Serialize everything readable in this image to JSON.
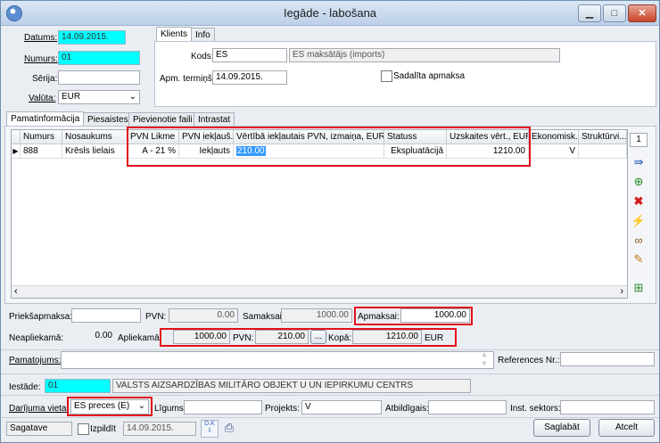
{
  "window": {
    "title": "Iegāde - labošana",
    "minimize": "▁",
    "maximize": "□",
    "close": "✕"
  },
  "header": {
    "datums_label": "Datums:",
    "datums_value": "14.09.2015.",
    "numurs_label": "Numurs:",
    "numurs_value": "01",
    "serija_label": "Sērija:",
    "serija_value": "",
    "valuta_label": "Valūta:",
    "valuta_value": "EUR"
  },
  "client": {
    "tabs": [
      "Klients",
      "Info"
    ],
    "kods_label": "Kods:",
    "kods_value": "ES",
    "kods_name": "ES maksātājs (imports)",
    "term_label": "Apm. termiņš:",
    "term_value": "14.09.2015.",
    "split_label": "Sadalīta apmaksa"
  },
  "main_tabs": [
    "Pamatinformācija",
    "Piesaistes",
    "Pievienotie faili",
    "Intrastat"
  ],
  "grid": {
    "columns": [
      "Numurs",
      "Nosaukums",
      "PVN Likme",
      "PVN iekļaušana",
      "Vērtībā iekļautais PVN, izmaiņa, EUR",
      "Statuss",
      "Uzskaites vērt., EUR",
      "Ekonomiskā",
      "Struktūrvienība"
    ],
    "columns_display": [
      "Numurs",
      "Nosaukums",
      "PVN Likme",
      "PVN iekļauš...",
      "Vērtībā iekļautais PVN, izmaiņa, EUR",
      "Statuss",
      "Uzskaites vērt., EUR",
      "Ekonomisk...",
      "Struktūrvi..."
    ],
    "row": {
      "numurs": "888",
      "nosaukums": "Krēsls lielais",
      "pvn_likme": "A - 21 %",
      "pvn_ieklausana": "Iekļauts",
      "vertiba": "210.00",
      "statuss": "Ekspluatācijā",
      "uzskaites": "1210.00",
      "ekonomiska": "V",
      "struktura": ""
    },
    "side_count": "1"
  },
  "totals": {
    "prieksapmaksa_label": "Priekšapmaksa:",
    "prieksapmaksa_value": "",
    "pvn1_label": "PVN:",
    "pvn1_value": "0.00",
    "samaksai_label": "Samaksai:",
    "samaksai_value": "1000.00",
    "apmaksai_label": "Apmaksai:",
    "apmaksai_value": "1000.00",
    "neapliekama_label": "Neapliekamā:",
    "neapliekama_value": "0.00",
    "apliekama_label": "Apliekamā:",
    "apliekama_value": "1000.00",
    "pvn2_label": "PVN:",
    "pvn2_value": "210.00",
    "dots": "...",
    "kopa_label": "Kopā:",
    "kopa_value": "1210.00",
    "kopa_currency": "EUR"
  },
  "footer": {
    "pamatojums_label": "Pamatojums:",
    "pamatojums_value": "",
    "references_label": "References Nr.:",
    "references_value": "",
    "iestade_label": "Iestāde:",
    "iestade_code": "01",
    "iestade_name": "VALSTS AIZSARDZĪBAS MILITĀRO OBJEKT U UN IEPIRKUMU CENTRS",
    "darijuma_label": "Darījuma vieta:",
    "darijuma_value": "ES preces (E)",
    "ligums_label": "Līgums:",
    "ligums_value": "",
    "projekts_label": "Projekts:",
    "projekts_value": "V",
    "atbildigais_label": "Atbildīgais:",
    "atbildigais_value": "",
    "inst_label": "Inst. sektors:",
    "inst_value": "",
    "status_value": "Sagatave",
    "izpildit_label": "Izpildīt",
    "izpildit_date": "14.09.2015.",
    "dk_label": "D.K",
    "save_label": "Saglabāt",
    "cancel_label": "Atcelt"
  }
}
